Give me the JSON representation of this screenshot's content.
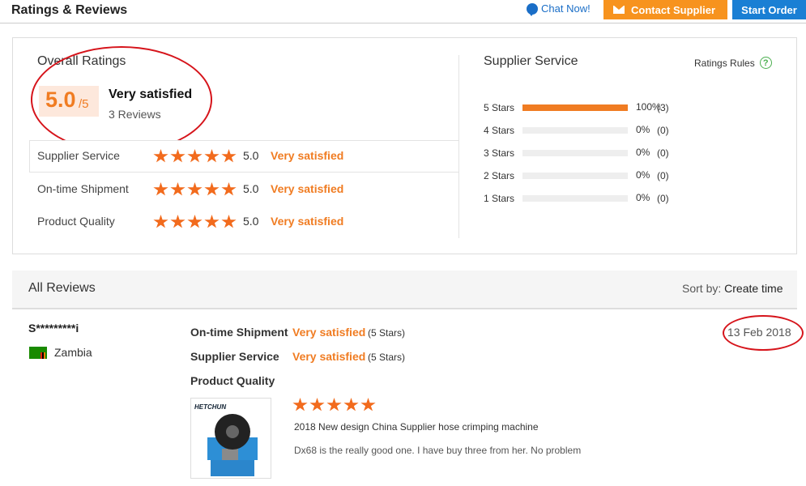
{
  "header": {
    "title": "Ratings & Reviews",
    "chat_label": "Chat Now!",
    "contact_label": "Contact Supplier",
    "start_order_label": "Start Order"
  },
  "overall": {
    "title": "Overall Ratings",
    "score": "5.0",
    "score_den": "/5",
    "satisfaction": "Very satisfied",
    "reviews": "3 Reviews",
    "rows": [
      {
        "label": "Supplier Service",
        "value": "5.0",
        "sat": "Very satisfied",
        "stars": 5
      },
      {
        "label": "On-time Shipment",
        "value": "5.0",
        "sat": "Very satisfied",
        "stars": 5
      },
      {
        "label": "Product Quality",
        "value": "5.0",
        "sat": "Very satisfied",
        "stars": 5
      }
    ]
  },
  "supplier_service": {
    "title": "Supplier Service",
    "rules_label": "Ratings Rules",
    "bars": [
      {
        "label": "5 Stars",
        "pct": "100%",
        "count": "(3)",
        "fraction": 1.0
      },
      {
        "label": "4 Stars",
        "pct": "0%",
        "count": "(0)",
        "fraction": 0
      },
      {
        "label": "3 Stars",
        "pct": "0%",
        "count": "(0)",
        "fraction": 0
      },
      {
        "label": "2 Stars",
        "pct": "0%",
        "count": "(0)",
        "fraction": 0
      },
      {
        "label": "1 Stars",
        "pct": "0%",
        "count": "(0)",
        "fraction": 0
      }
    ]
  },
  "reviews": {
    "title": "All Reviews",
    "sort_label": "Sort by:",
    "sort_value": "Create time",
    "items": [
      {
        "reviewer": "S*********i",
        "country": "Zambia",
        "date": "13 Feb 2018",
        "ratings": [
          {
            "label": "On-time Shipment",
            "sat": "Very satisfied",
            "stars": "(5 Stars)"
          },
          {
            "label": "Supplier Service",
            "sat": "Very satisfied",
            "stars": "(5 Stars)"
          },
          {
            "label": "Product Quality",
            "sat": "",
            "stars": ""
          }
        ],
        "product_stars": 5,
        "thumb_brand": "HETCHUN",
        "product_title": "2018 New design China Supplier hose crimping machine",
        "comment": "Dx68 is the really good one. I have buy three from her. No problem"
      }
    ]
  },
  "colors": {
    "accent": "#f07c22",
    "blue": "#1a7fd4",
    "annotation_red": "#d6141b"
  }
}
